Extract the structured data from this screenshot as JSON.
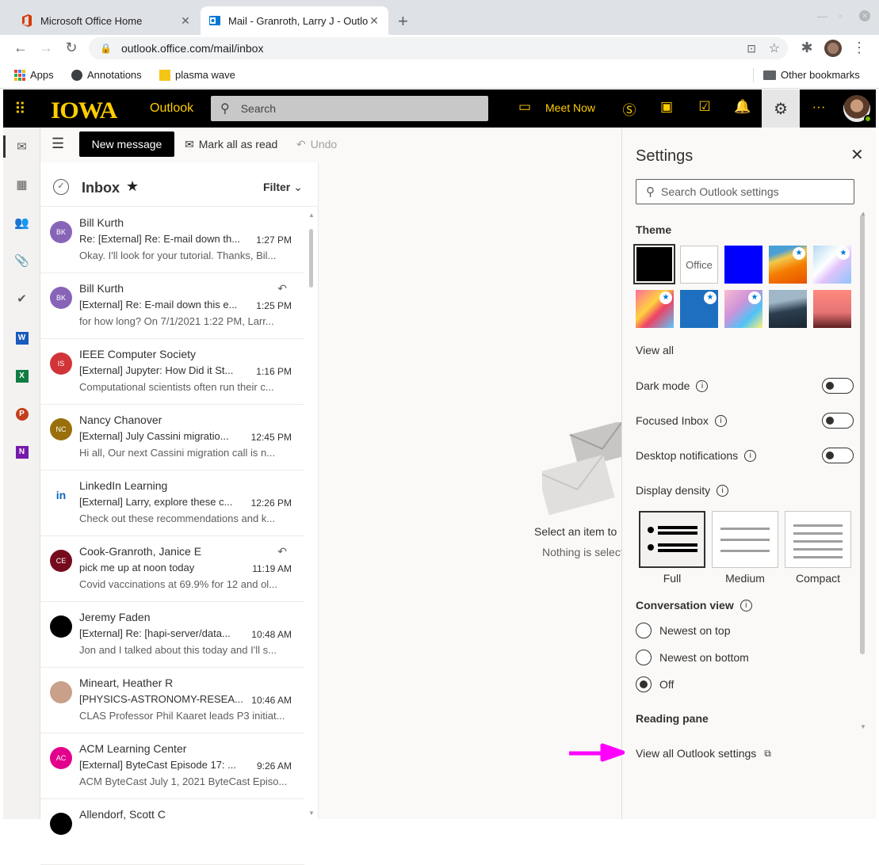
{
  "browser": {
    "tabs": [
      {
        "title": "Microsoft Office Home",
        "active": false
      },
      {
        "title": "Mail - Granroth, Larry J - Outlo",
        "active": true
      }
    ],
    "url": "outlook.office.com/mail/inbox",
    "bookmarks": [
      "Apps",
      "Annotations",
      "plasma wave"
    ],
    "other_bookmarks": "Other bookmarks"
  },
  "header": {
    "logo_text": "IOWA",
    "app_name": "Outlook",
    "search_placeholder": "Search",
    "meet_now": "Meet Now",
    "brand_color": "#ffcd00"
  },
  "commands": {
    "new_message": "New message",
    "mark_all_read": "Mark all as read",
    "undo": "Undo"
  },
  "inbox": {
    "title": "Inbox",
    "filter": "Filter",
    "messages": [
      {
        "initials": "BK",
        "color": "#8764b8",
        "from": "Bill Kurth",
        "subject": "Re: [External] Re: E-mail down th...",
        "time": "1:27 PM",
        "preview": "Okay. I'll look for your tutorial. Thanks, Bil...",
        "replied": false
      },
      {
        "initials": "BK",
        "color": "#8764b8",
        "from": "Bill Kurth",
        "subject": "[External] Re: E-mail down this e...",
        "time": "1:25 PM",
        "preview": "for how long? On 7/1/2021 1:22 PM, Larr...",
        "replied": true
      },
      {
        "initials": "IS",
        "color": "#d13438",
        "from": "IEEE Computer Society",
        "subject": "[External] Jupyter: How Did it St...",
        "time": "1:16 PM",
        "preview": "Computational scientists often run their c...",
        "replied": false
      },
      {
        "initials": "NC",
        "color": "#986f0b",
        "from": "Nancy Chanover",
        "subject": "[External] July Cassini migratio...",
        "time": "12:45 PM",
        "preview": "Hi all, Our next Cassini migration call is n...",
        "replied": false
      },
      {
        "initials": "in",
        "color": "#0a66c2",
        "from": "LinkedIn Learning",
        "subject": "[External] Larry, explore these c...",
        "time": "12:26 PM",
        "preview": "Check out these recommendations and k...",
        "replied": false
      },
      {
        "initials": "CE",
        "color": "#750b1c",
        "from": "Cook-Granroth, Janice E",
        "subject": "pick me up at noon today",
        "time": "11:19 AM",
        "preview": "Covid vaccinations at 69.9% for 12 and ol...",
        "replied": true
      },
      {
        "initials": "",
        "color": "#000000",
        "from": "Jeremy Faden",
        "subject": "[External] Re: [hapi-server/data...",
        "time": "10:48 AM",
        "preview": "Jon and I talked about this today and I'll s...",
        "replied": false
      },
      {
        "initials": "",
        "color": "#c9a089",
        "from": "Mineart, Heather R",
        "subject": "[PHYSICS-ASTRONOMY-RESEA...",
        "time": "10:46 AM",
        "preview": "CLAS Professor Phil Kaaret leads P3 initiat...",
        "replied": false
      },
      {
        "initials": "AC",
        "color": "#e3008c",
        "from": "ACM Learning Center",
        "subject": "[External] ByteCast Episode 17: ...",
        "time": "9:26 AM",
        "preview": "ACM ByteCast July 1, 2021 ByteCast Episo...",
        "replied": false
      },
      {
        "initials": "",
        "color": "#000000",
        "from": "Allendorf, Scott C",
        "subject": "",
        "time": "",
        "preview": "",
        "replied": false
      }
    ]
  },
  "reading": {
    "select_item": "Select an item to",
    "nothing_selected": "Nothing is select"
  },
  "settings": {
    "title": "Settings",
    "search_placeholder": "Search Outlook settings",
    "theme_label": "Theme",
    "office_theme": "Office",
    "view_all": "View all",
    "dark_mode": "Dark mode",
    "focused_inbox": "Focused Inbox",
    "desktop_notifications": "Desktop notifications",
    "display_density": "Display density",
    "density_options": [
      "Full",
      "Medium",
      "Compact"
    ],
    "conversation_view": "Conversation view",
    "conversation_options": [
      "Newest on top",
      "Newest on bottom",
      "Off"
    ],
    "reading_pane": "Reading pane",
    "view_all_settings": "View all Outlook settings"
  }
}
